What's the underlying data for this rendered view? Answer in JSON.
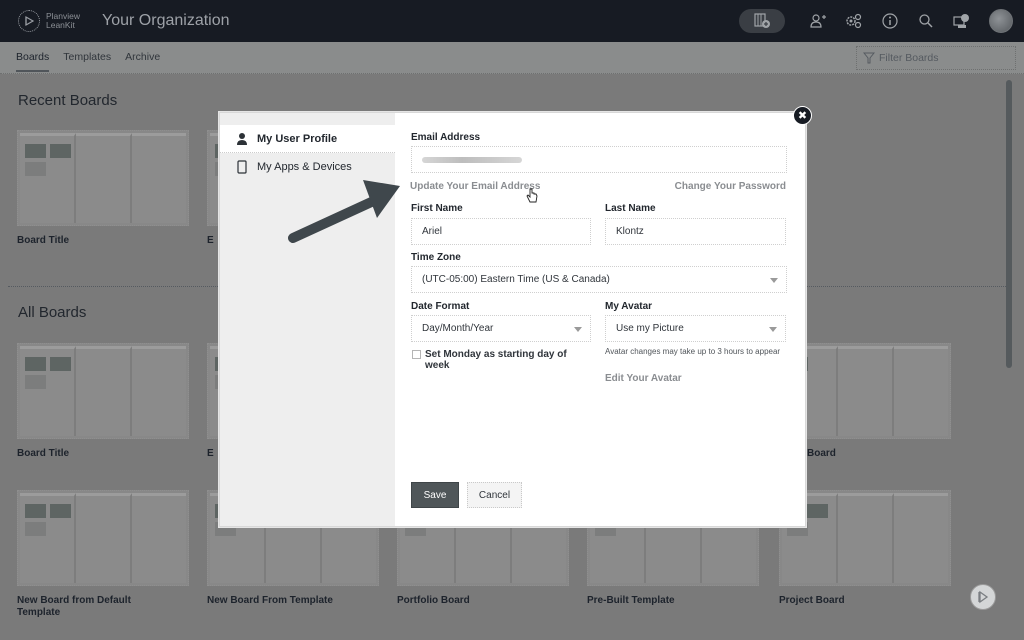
{
  "header": {
    "logo_line1": "Planview",
    "logo_line2": "LeanKit",
    "org_title": "Your Organization",
    "icons": [
      "add-board-icon",
      "add-user-icon",
      "settings-gears-icon",
      "info-icon",
      "search-icon",
      "notifications-icon",
      "user-avatar"
    ]
  },
  "subnav": {
    "tabs": [
      {
        "label": "Boards",
        "active": true
      },
      {
        "label": "Templates",
        "active": false
      },
      {
        "label": "Archive",
        "active": false
      }
    ],
    "filter_placeholder": "Filter Boards"
  },
  "recent_boards": {
    "title": "Recent Boards",
    "boards": [
      {
        "label": "Board Title"
      },
      {
        "label": "E"
      }
    ]
  },
  "all_boards": {
    "title": "All Boards",
    "row1": [
      {
        "label": "Board Title"
      },
      {
        "label": "E"
      },
      {
        "label": "Board"
      }
    ],
    "row2": [
      {
        "label": "New Board from Default Template"
      },
      {
        "label": "New Board From Template"
      },
      {
        "label": "Portfolio Board"
      },
      {
        "label": "Pre-Built Template"
      },
      {
        "label": "Project Board"
      }
    ]
  },
  "modal": {
    "sidebar": [
      {
        "label": "My User Profile",
        "icon": "user-icon",
        "active": true
      },
      {
        "label": "My Apps & Devices",
        "icon": "mobile-device-icon",
        "active": false
      }
    ],
    "email_label": "Email Address",
    "email_value": "(blurred)",
    "update_email_link": "Update Your Email Address",
    "change_password_link": "Change Your Password",
    "first_name_label": "First Name",
    "first_name_value": "Ariel",
    "last_name_label": "Last Name",
    "last_name_value": "Klontz",
    "timezone_label": "Time Zone",
    "timezone_value": "(UTC-05:00) Eastern Time (US & Canada)",
    "date_format_label": "Date Format",
    "date_format_value": "Day/Month/Year",
    "avatar_label": "My Avatar",
    "avatar_value": "Use my Picture",
    "avatar_hint": "Avatar changes may take up to 3 hours to appear",
    "edit_avatar_link": "Edit Your Avatar",
    "monday_checkbox_label": "Set Monday as starting day of week",
    "monday_checked": false,
    "save_label": "Save",
    "cancel_label": "Cancel",
    "close_label": "✖"
  },
  "colors": {
    "topbar": "#171b23",
    "overlay_bg": "#7a7a7a",
    "save_button": "#4f5659",
    "link_gray": "#8a8d91"
  }
}
